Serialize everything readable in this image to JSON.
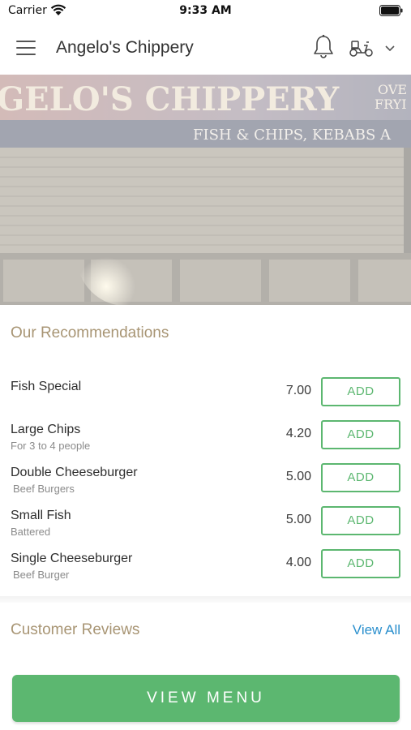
{
  "status_bar": {
    "carrier": "Carrier",
    "time": "9:33 AM",
    "icons": [
      "wifi-icon",
      "battery-icon"
    ]
  },
  "header": {
    "title": "Angelo's Chippery",
    "icons": [
      "menu-icon",
      "bell-icon",
      "scooter-icon",
      "chevron-down-icon"
    ]
  },
  "hero": {
    "sign_text": "GELO'S CHIPPERY",
    "sign_subtext": "FISH & CHIPS, KEBABS A",
    "sign_corner_1": "OVE",
    "sign_corner_2": "FRYI"
  },
  "recommendations": {
    "title": "Our Recommendations",
    "add_label": "ADD",
    "items": [
      {
        "name": "Fish Special",
        "description": "",
        "price": "7.00"
      },
      {
        "name": "Large Chips",
        "description": "For 3 to 4 people",
        "price": "4.20"
      },
      {
        "name": "Double Cheeseburger",
        "description": "Beef Burgers",
        "price": "5.00"
      },
      {
        "name": "Small Fish",
        "description": "Battered",
        "price": "5.00"
      },
      {
        "name": "Single Cheeseburger",
        "description": "Beef Burger",
        "price": "4.00"
      }
    ]
  },
  "reviews": {
    "title": "Customer Reviews",
    "view_all": "View All"
  },
  "cta": {
    "label": "VIEW MENU"
  },
  "colors": {
    "accent_green": "#5cb770",
    "section_title": "#a89574",
    "link_blue": "#2a8fcd"
  }
}
